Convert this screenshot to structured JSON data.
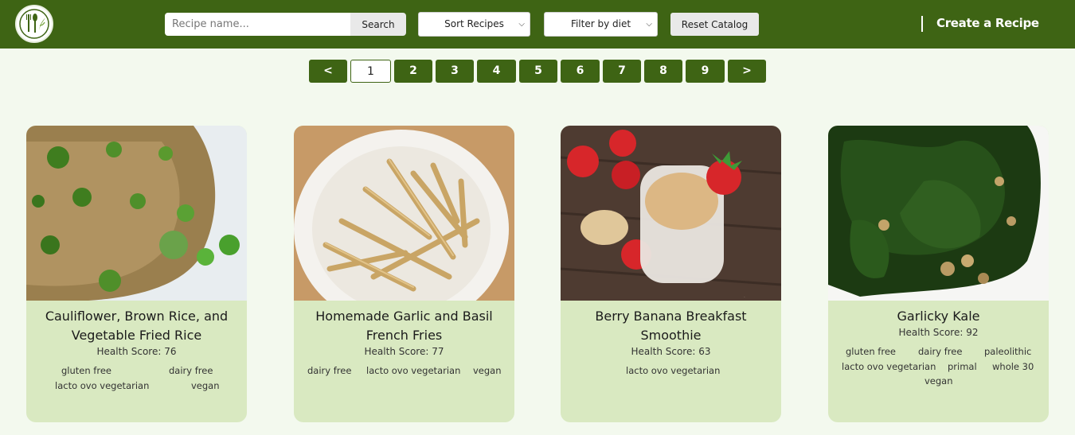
{
  "navbar": {
    "search_placeholder": "Recipe name...",
    "search_button": "Search",
    "sort_select": "Sort Recipes",
    "diet_select": "Filter by diet",
    "reset_button": "Reset Catalog",
    "create_link": "Create a Recipe",
    "accent_color": "#3e6414"
  },
  "pagination": {
    "prev": "<",
    "pages": [
      "1",
      "2",
      "3",
      "4",
      "5",
      "6",
      "7",
      "8",
      "9"
    ],
    "current": "1",
    "next": ">"
  },
  "recipes": [
    {
      "title_lines": [
        "Cauliflower, Brown Rice, and",
        "Vegetable Fried Rice"
      ],
      "health_score": "Health Score: 76",
      "diets": [
        "gluten free",
        "dairy free",
        "lacto ovo vegetarian",
        "vegan"
      ]
    },
    {
      "title_lines": [
        "Homemade Garlic and Basil",
        "French Fries"
      ],
      "health_score": "Health Score: 77",
      "diets": [
        "dairy free",
        "lacto ovo vegetarian",
        "vegan"
      ]
    },
    {
      "title_lines": [
        "Berry Banana Breakfast",
        "Smoothie"
      ],
      "health_score": "Health Score: 63",
      "diets": [
        "lacto ovo vegetarian"
      ]
    },
    {
      "title_lines": [
        "Garlicky Kale"
      ],
      "health_score": "Health Score: 92",
      "diets": [
        "gluten free",
        "dairy free",
        "paleolithic",
        "lacto ovo vegetarian",
        "primal",
        "whole 30",
        "vegan"
      ]
    }
  ]
}
